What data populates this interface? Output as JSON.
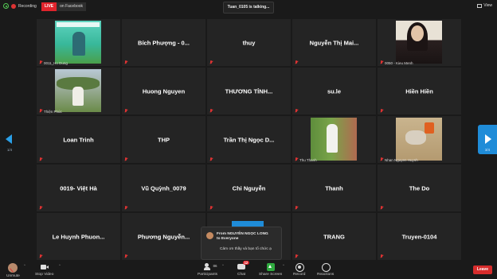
{
  "topbar": {
    "recording_label": "Recording",
    "live_label": "LIVE",
    "live_platform": "on Facebook",
    "talking_text": "Tuan_0105 is talking...",
    "view_label": "View"
  },
  "navigation": {
    "left_page": "1/4",
    "right_page": "3/4"
  },
  "tiles": [
    {
      "name": "",
      "label": "0011_Ho Dung",
      "photo": "p1"
    },
    {
      "name": "Bích Phượng - 0...",
      "label": ""
    },
    {
      "name": "thuy",
      "label": ""
    },
    {
      "name": "Nguyễn Thị Mai...",
      "label": ""
    },
    {
      "name": "",
      "label": "0050 - Kieu Menh",
      "photo": "p2"
    },
    {
      "name": "",
      "label": "Thiện Phúc",
      "photo": "p3"
    },
    {
      "name": "Huong Nguyen",
      "label": ""
    },
    {
      "name": "THƯƠNG TỈNH...",
      "label": ""
    },
    {
      "name": "su.le",
      "label": ""
    },
    {
      "name": "Hiền Hiền",
      "label": ""
    },
    {
      "name": "Loan Trinh",
      "label": ""
    },
    {
      "name": "THP",
      "label": ""
    },
    {
      "name": "Trần Thị Ngọc D...",
      "label": ""
    },
    {
      "name": "",
      "label": "Thu Thanh",
      "photo": "p4"
    },
    {
      "name": "",
      "label": "Nhan Nguyen Huynh",
      "photo": "p5"
    },
    {
      "name": "0019- Việt Hà",
      "label": ""
    },
    {
      "name": "Vũ Quỳnh_0079",
      "label": ""
    },
    {
      "name": "Chi Nguyễn",
      "label": ""
    },
    {
      "name": "Thanh",
      "label": ""
    },
    {
      "name": "The Do",
      "label": ""
    },
    {
      "name": "Le Huynh Phuon...",
      "label": ""
    },
    {
      "name": "Phương Nguyễn...",
      "label": ""
    },
    {
      "name": "",
      "label": ""
    },
    {
      "name": "TRANG",
      "label": ""
    },
    {
      "name": "Truyen-0104",
      "label": ""
    }
  ],
  "chat_popup": {
    "from_line1": "From NGUYỄN NGỌC LONG",
    "from_line2": "to Everyone",
    "message": "Cảm ơn thầy và bạn tổ chức ạ"
  },
  "toolbar": {
    "unmute_label": "Unmute",
    "stop_video_label": "Stop Video",
    "participants_label": "Participants",
    "participants_count": "86",
    "chat_label": "Chat",
    "chat_badge": "12",
    "share_label": "Share Screen",
    "record_label": "Record",
    "reactions_label": "Reactions",
    "leave_label": "Leave"
  }
}
